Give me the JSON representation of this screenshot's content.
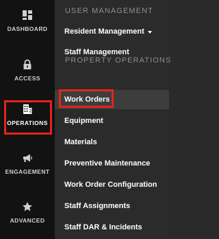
{
  "rail": {
    "items": [
      {
        "label": "DASHBOARD",
        "icon": "dashboard-icon"
      },
      {
        "label": "ACCESS",
        "icon": "lock-icon"
      },
      {
        "label": "OPERATIONS",
        "icon": "building-icon"
      },
      {
        "label": "ENGAGEMENT",
        "icon": "megaphone-icon"
      },
      {
        "label": "ADVANCED",
        "icon": "star-icon"
      }
    ],
    "selected": "OPERATIONS"
  },
  "menu": {
    "user_management": {
      "title": "USER MANAGEMENT",
      "items": [
        {
          "label": "Resident Management",
          "has_dropdown": true
        },
        {
          "label": "Staff Management"
        }
      ]
    },
    "property_operations": {
      "title": "PROPERTY OPERATIONS",
      "items": [
        {
          "label": "Work Orders",
          "active": true
        },
        {
          "label": "Equipment"
        },
        {
          "label": "Materials"
        },
        {
          "label": "Preventive Maintenance"
        },
        {
          "label": "Work Order Configuration"
        },
        {
          "label": "Staff Assignments"
        },
        {
          "label": "Staff DAR & Incidents"
        }
      ]
    }
  },
  "colors": {
    "rail_bg": "#121212",
    "menu_bg": "#2b2b2b",
    "active_item_bg": "#3d3d3d",
    "highlight": "#e8231a",
    "section_title": "#8f8f8f"
  }
}
